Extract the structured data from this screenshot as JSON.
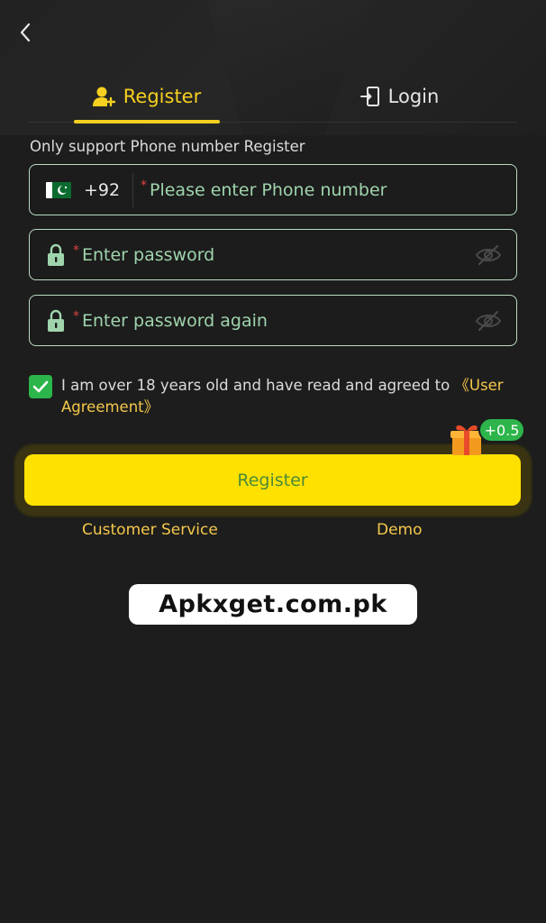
{
  "tabs": {
    "register": "Register",
    "login": "Login"
  },
  "hint": "Only support Phone number Register",
  "phone": {
    "country_code": "+92",
    "placeholder": "Please enter Phone number",
    "required_mark": "*"
  },
  "password": {
    "placeholder": "Enter password",
    "required_mark": "*"
  },
  "password_again": {
    "placeholder": "Enter password again",
    "required_mark": "*"
  },
  "agreement": {
    "text": "I am over 18 years old and have read and agreed to ",
    "link": "《User Agreement》",
    "checked": true
  },
  "register_button": "Register",
  "bonus_badge": "+0.5",
  "links": {
    "customer_service": "Customer Service",
    "demo": "Demo"
  },
  "watermark": "Apkxget.com.pk",
  "colors": {
    "accent": "#f5d020",
    "field_border": "#b9dcc3",
    "button": "#ffe100",
    "check": "#2bb54a",
    "bonus": "#2db54b"
  },
  "icons": {
    "back": "chevron-left-icon",
    "register_tab": "user-add-icon",
    "login_tab": "login-door-icon",
    "flag": "pakistan-flag-icon",
    "lock": "lock-icon",
    "eye": "eye-off-icon",
    "gift": "gift-icon"
  }
}
